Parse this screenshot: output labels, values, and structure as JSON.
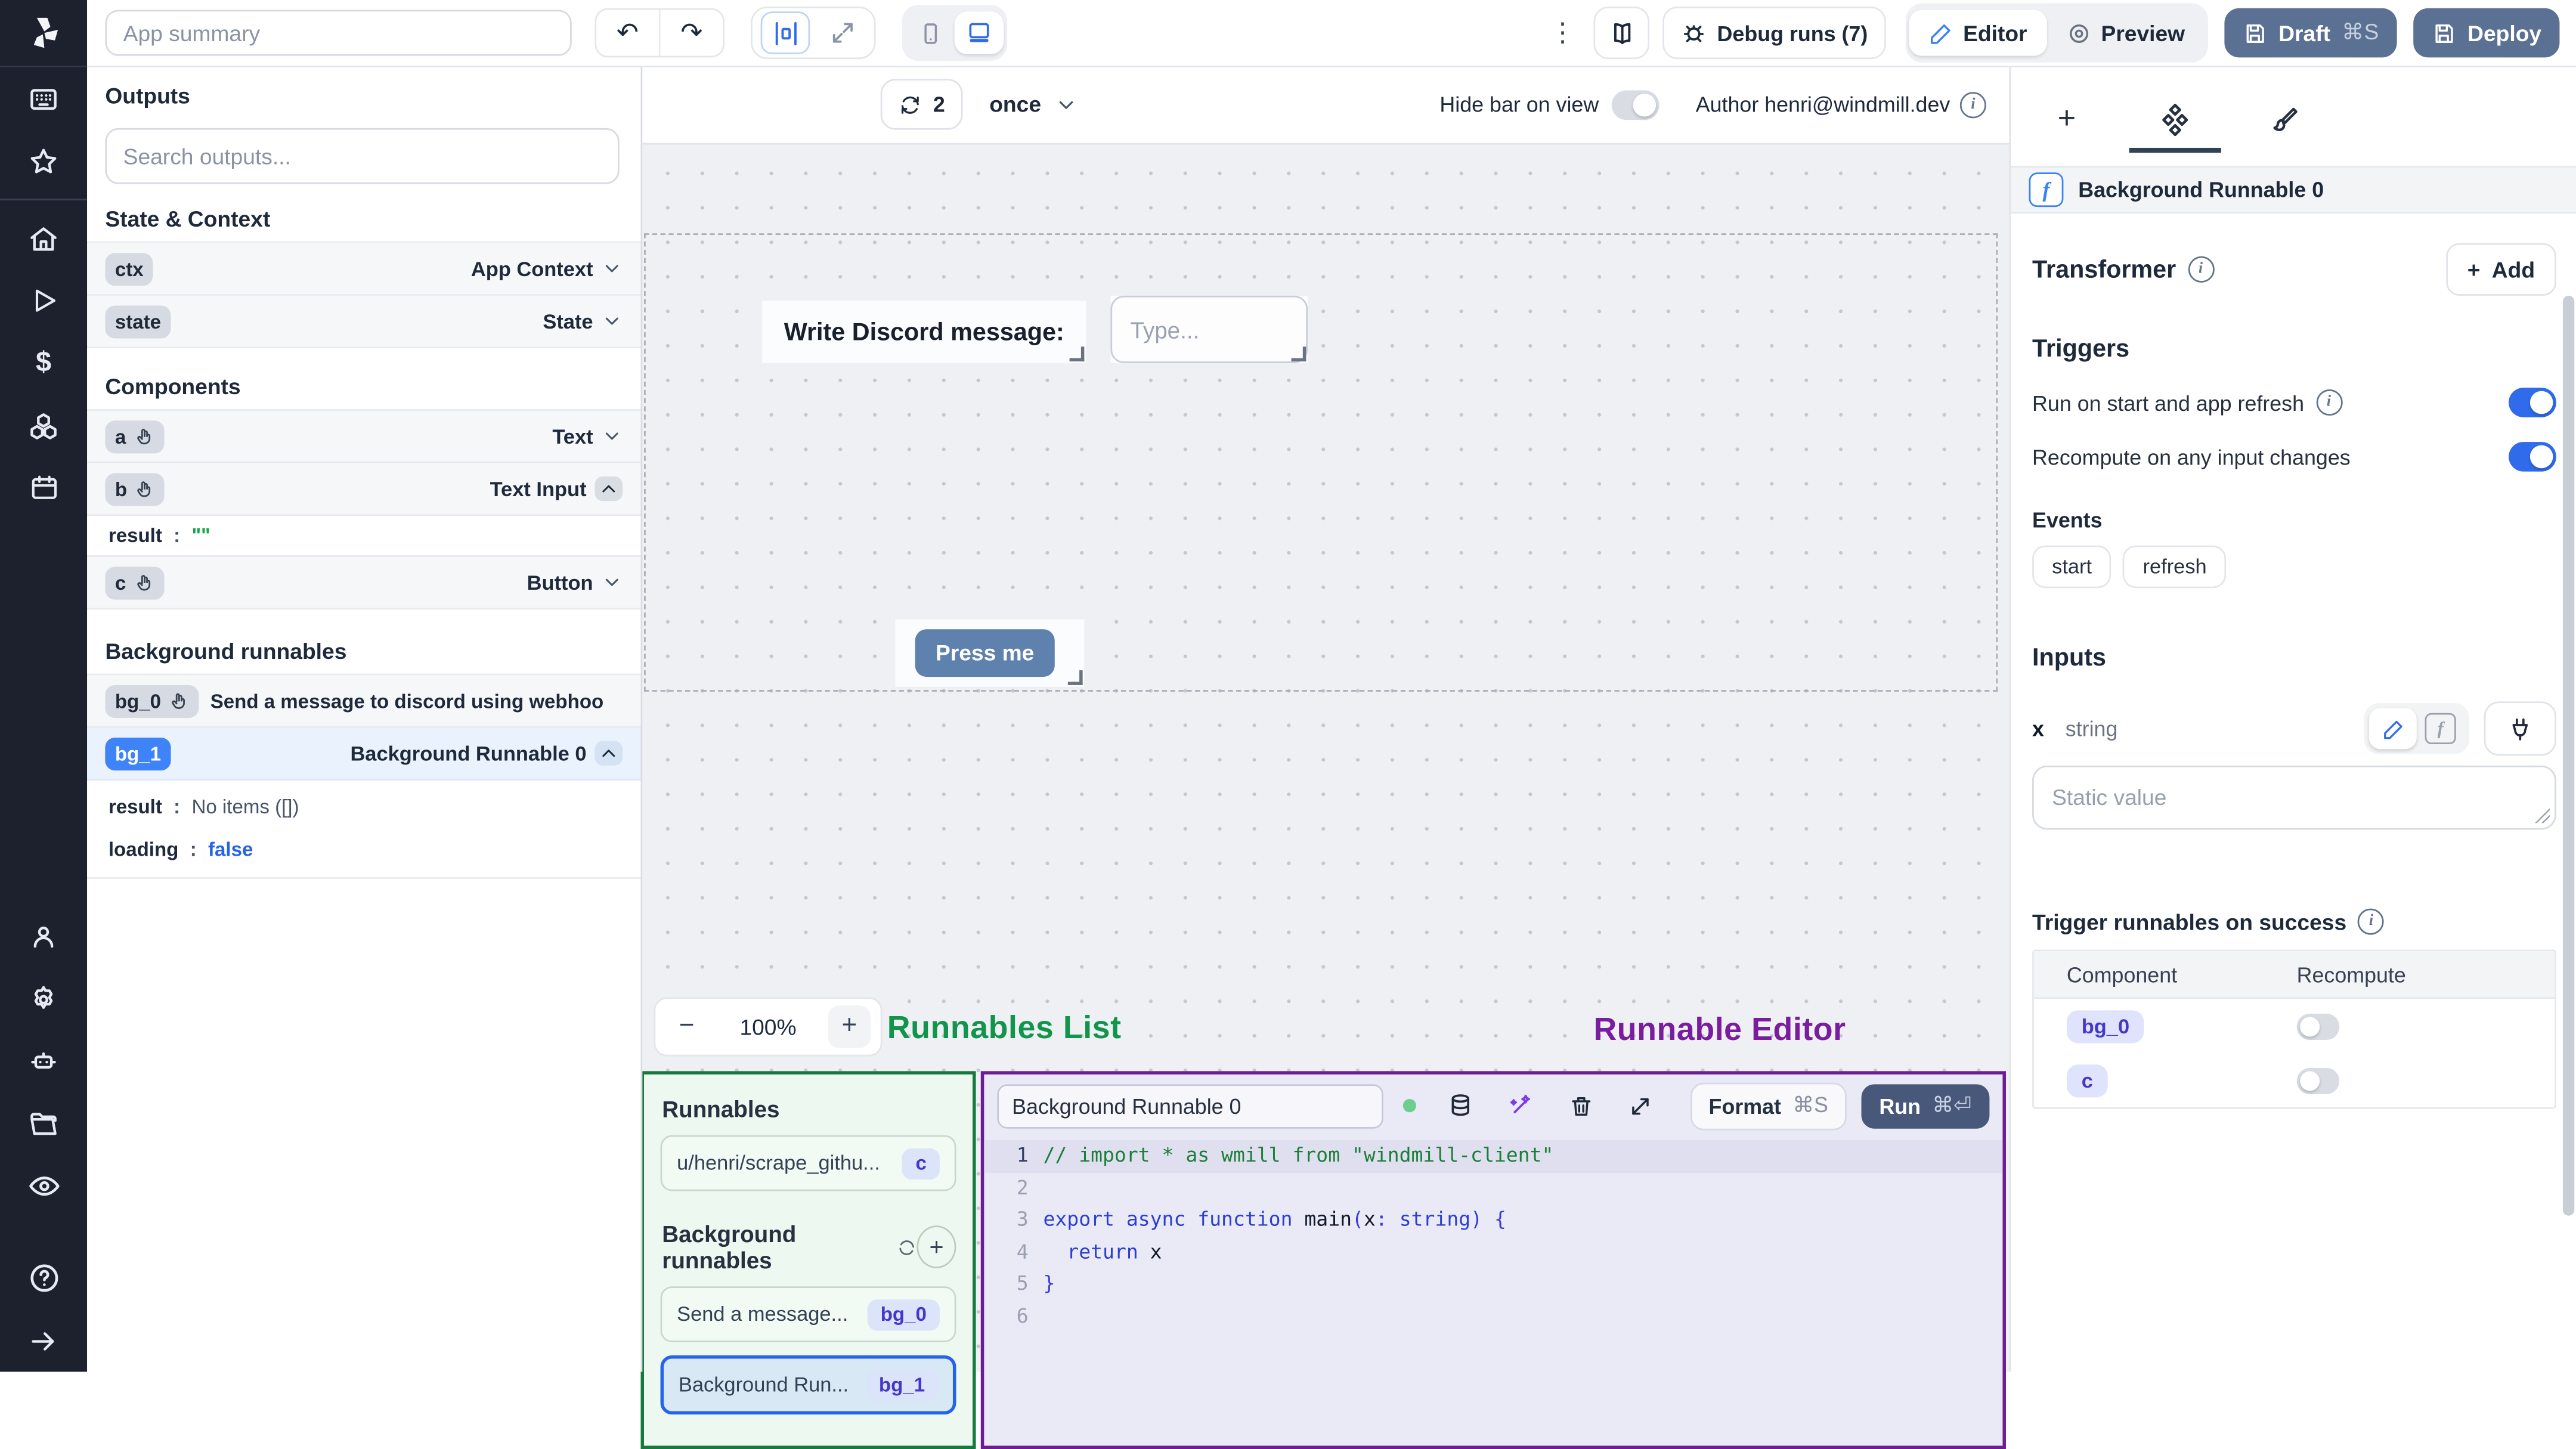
{
  "topbar": {
    "app_summary_placeholder": "App summary",
    "undo": "↶",
    "redo": "↷",
    "kebab": "⋮",
    "debug_runs_label": "Debug runs (7)",
    "editor_label": "Editor",
    "preview_label": "Preview",
    "draft_label": "Draft",
    "draft_shortcut": "⌘S",
    "deploy_label": "Deploy"
  },
  "outputs_panel": {
    "title": "Outputs",
    "search_placeholder": "Search outputs...",
    "state_context_title": "State & Context",
    "ctx_id": "ctx",
    "ctx_type": "App Context",
    "state_id": "state",
    "state_type": "State",
    "components_title": "Components",
    "a_id": "a",
    "a_type": "Text",
    "b_id": "b",
    "b_type": "Text Input",
    "b_result_key": "result",
    "b_result_colon": ":",
    "b_result_value": "\"\"",
    "c_id": "c",
    "c_type": "Button",
    "background_title": "Background runnables",
    "bg0_id": "bg_0",
    "bg0_label": "Send a message to discord using webhoo",
    "bg1_id": "bg_1",
    "bg1_label": "Background Runnable 0",
    "bg1_result_key": "result",
    "bg1_result_colon": ":",
    "bg1_result_value": "No items ([])",
    "bg1_loading_key": "loading",
    "bg1_loading_colon": ":",
    "bg1_loading_value": "false"
  },
  "canvas": {
    "refresh_count": "2",
    "interval": "once",
    "hide_bar_label": "Hide bar on view",
    "author": "Author henri@windmill.dev",
    "info_i": "i",
    "text_component": "Write Discord message:",
    "input_placeholder": "Type...",
    "button_label": "Press me",
    "zoom_out": "−",
    "zoom_level": "100%",
    "zoom_in": "+"
  },
  "annotations": {
    "runnables_list": "Runnables List",
    "runnable_editor": "Runnable Editor"
  },
  "runnables_panel": {
    "title": "Runnables",
    "item1_label": "u/henri/scrape_githu...",
    "item1_badge": "c",
    "background_title": "Background runnables",
    "add_plus": "+",
    "item2_label": "Send a message...",
    "item2_badge": "bg_0",
    "item3_label": "Background Run...",
    "item3_badge": "bg_1"
  },
  "editor_panel": {
    "name_value": "Background Runnable 0",
    "format_label": "Format",
    "format_shortcut": "⌘S",
    "run_label": "Run",
    "run_shortcut": "⌘⏎",
    "code_lines": [
      {
        "n": "1",
        "t0": "// import * as wmill from \"windmill-client\""
      },
      {
        "n": "2"
      },
      {
        "n": "3",
        "t0": "export async function",
        "t1": " main",
        "t2": "(",
        "t3": "x",
        "t4": ":",
        "t5": " string",
        "t6": ")",
        "t7": " {"
      },
      {
        "n": "4",
        "t0": "  return",
        "t1": " x"
      },
      {
        "n": "5",
        "t0": "}"
      },
      {
        "n": "6"
      }
    ]
  },
  "right_panel": {
    "plus_tab": "+",
    "header_icon": "f",
    "header_title": "Background Runnable 0",
    "transformer_title": "Transformer",
    "add_plus": "+",
    "add_label": "Add",
    "triggers_title": "Triggers",
    "trigger1_label": "Run on start and app refresh",
    "trigger2_label": "Recompute on any input changes",
    "events_title": "Events",
    "event_chip1": "start",
    "event_chip2": "refresh",
    "inputs_title": "Inputs",
    "input_name": "x",
    "input_type": "string",
    "f_mini": "f",
    "static_placeholder": "Static value",
    "success_title": "Trigger runnables on success",
    "table": {
      "col1": "Component",
      "col2": "Recompute",
      "row1_badge": "bg_0",
      "row2_badge": "c"
    },
    "info_i": "i"
  }
}
